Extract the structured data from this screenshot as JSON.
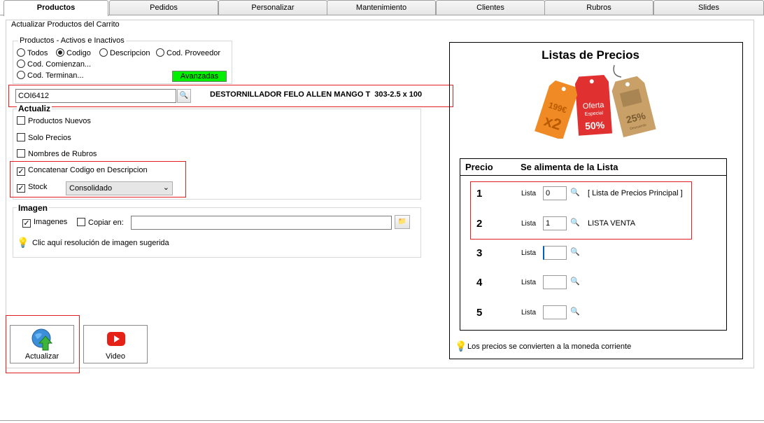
{
  "tabs": [
    "Productos",
    "Pedidos",
    "Personalizar",
    "Mantenimiento",
    "Clientes",
    "Rubros",
    "Slides"
  ],
  "panel_title": "Actualizar Productos del Carrito",
  "productos_group": {
    "title": "Productos - Activos e Inactivos",
    "radios": [
      "Todos",
      "Codigo",
      "Descripcion",
      "Cod. Proveedor",
      "Cod. Comienzan...",
      "Cod. Terminan..."
    ],
    "selected": "Codigo",
    "avanzadas_label": "Avanzadas",
    "avanzadas_color": "#00ee00"
  },
  "search": {
    "value": "COI6412",
    "description": "DESTORNILLADOR FELO ALLEN MANGO T  303-2.5 x 100"
  },
  "actualiz_group": {
    "title": "Actualiz",
    "checks": [
      {
        "label": "Productos Nuevos",
        "checked": false
      },
      {
        "label": "Solo Precios",
        "checked": false
      },
      {
        "label": "Nombres de Rubros",
        "checked": false
      },
      {
        "label": "Concatenar Codigo en Descripcion",
        "checked": true
      },
      {
        "label": "Stock",
        "checked": true
      }
    ],
    "stock_select": "Consolidado"
  },
  "imagen_group": {
    "title": "Imagen",
    "imagenes_label": "Imagenes",
    "copiar_label": "Copiar en:",
    "copiar_value": "",
    "hint": "Clic aquí resolución de imagen sugerida"
  },
  "buttons": {
    "actualizar": "Actualizar",
    "video": "Video"
  },
  "listas": {
    "title": "Listas de Precios",
    "header_precio": "Precio",
    "header_alimenta": "Se alimenta de la Lista",
    "lista_label": "Lista",
    "rows": [
      {
        "num": "1",
        "value": "0",
        "name": "[ Lista de Precios Principal ]"
      },
      {
        "num": "2",
        "value": "1",
        "name": "LISTA VENTA"
      },
      {
        "num": "3",
        "value": "",
        "name": ""
      },
      {
        "num": "4",
        "value": "",
        "name": ""
      },
      {
        "num": "5",
        "value": "",
        "name": ""
      }
    ],
    "tags": [
      "199€",
      "x2",
      "Oferta",
      "Especial",
      "50%",
      "25%",
      "Descuento"
    ],
    "footer": "Los precios se convierten a la moneda corriente"
  },
  "colors": {
    "highlight_border": "#e02020",
    "tag_orange": "#f08a24",
    "tag_red": "#e03030",
    "tag_tan": "#c8a068"
  }
}
